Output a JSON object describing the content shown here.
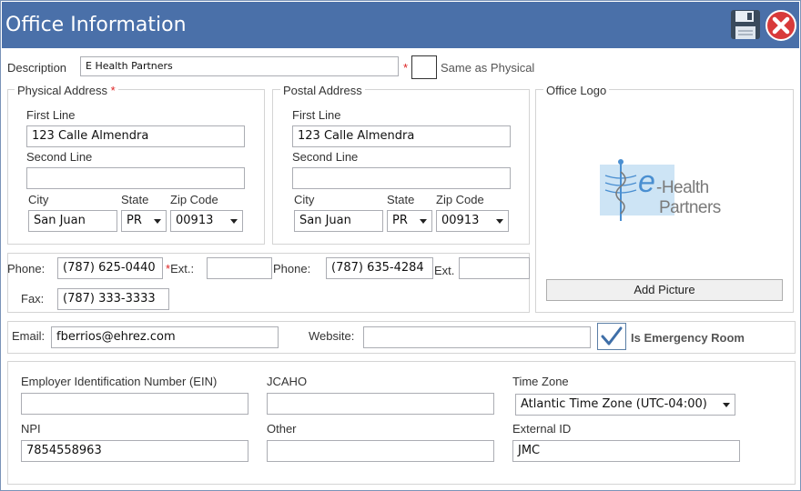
{
  "window": {
    "title": "Office Information"
  },
  "toolbar": {
    "save_icon": "floppy-disk-icon",
    "close_icon": "close-circle-icon"
  },
  "description": {
    "label": "Description",
    "value": "E Health Partners",
    "required_mark": "*",
    "same_as_physical_label": "Same as Physical",
    "same_as_physical_checked": false
  },
  "physical": {
    "title": "Physical Address",
    "required_mark": "*",
    "first_line_label": "First Line",
    "first_line": "123 Calle Almendra",
    "second_line_label": "Second Line",
    "second_line": "",
    "city_label": "City",
    "city": "San Juan",
    "state_label": "State",
    "state": "PR",
    "zip_label": "Zip Code",
    "zip": "00913"
  },
  "postal": {
    "title": "Postal Address",
    "first_line_label": "First Line",
    "first_line": "123 Calle Almendra",
    "second_line_label": "Second Line",
    "second_line": "",
    "city_label": "City",
    "city": "San Juan",
    "state_label": "State",
    "state": "PR",
    "zip_label": "Zip Code",
    "zip": "00913"
  },
  "logo": {
    "title": "Office Logo",
    "brand_e": "e",
    "brand_health": "-Health",
    "brand_partners": "Partners",
    "add_picture_label": "Add Picture",
    "colors": {
      "blue": "#4a8fd1",
      "gray": "#7a7a7a",
      "light": "#cde4f5"
    }
  },
  "phones": {
    "phone1_label": "Phone:",
    "phone1": "(787) 625-0440",
    "ext1_mark": "*",
    "ext1_label": "Ext.:",
    "ext1": "",
    "phone2_label": "Phone:",
    "phone2": "(787) 635-4284",
    "ext2_label": "Ext.",
    "ext2": "",
    "fax_label": "Fax:",
    "fax": "(787) 333-3333"
  },
  "contact": {
    "email_label": "Email:",
    "email": "fberrios@ehrez.com",
    "website_label": "Website:",
    "website": "",
    "emergency_label": "Is Emergency Room",
    "emergency_checked": true
  },
  "ids": {
    "ein_label": "Employer Identification Number (EIN)",
    "ein": "",
    "jcaho_label": "JCAHO",
    "jcaho": "",
    "tz_label": "Time Zone",
    "tz": "Atlantic Time Zone (UTC-04:00)",
    "npi_label": "NPI",
    "npi": "7854558963",
    "other_label": "Other",
    "other": "",
    "external_label": "External ID",
    "external": "JMC"
  },
  "colors": {
    "titlebar": "#4a70a9",
    "required": "#dd2222",
    "checkmark": "#3f6fa8"
  }
}
